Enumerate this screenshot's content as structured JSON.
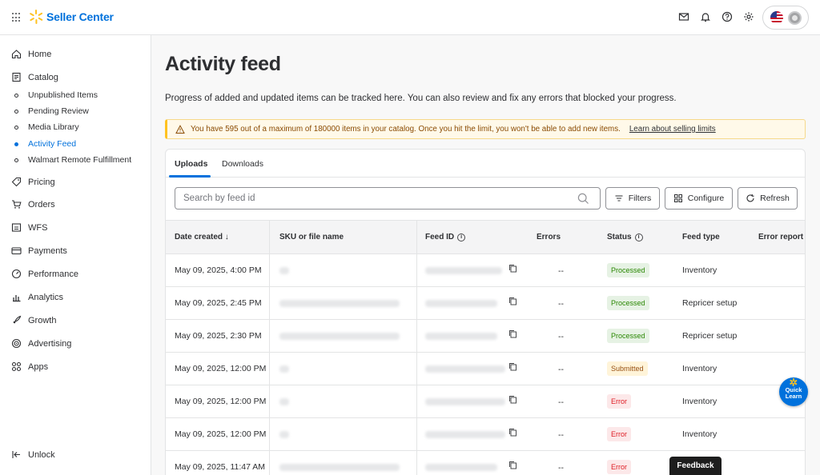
{
  "header": {
    "logo_text": "Seller Center"
  },
  "sidebar": {
    "items": [
      {
        "label": "Home"
      },
      {
        "label": "Catalog"
      },
      {
        "label": "Pricing"
      },
      {
        "label": "Orders"
      },
      {
        "label": "WFS"
      },
      {
        "label": "Payments"
      },
      {
        "label": "Performance"
      },
      {
        "label": "Analytics"
      },
      {
        "label": "Growth"
      },
      {
        "label": "Advertising"
      },
      {
        "label": "Apps"
      }
    ],
    "catalog_sub": [
      {
        "label": "Unpublished Items"
      },
      {
        "label": "Pending Review"
      },
      {
        "label": "Media Library"
      },
      {
        "label": "Activity Feed"
      },
      {
        "label": "Walmart Remote Fulfillment"
      }
    ],
    "unlock_label": "Unlock"
  },
  "main": {
    "title": "Activity feed",
    "description": "Progress of added and updated items can be tracked here. You can also review and fix any errors that blocked your progress.",
    "alert_text": "You have 595 out of a maximum of 180000 items in your catalog. Once you hit the limit, you won't be able to add new items.",
    "alert_link": "Learn about selling limits"
  },
  "tabs": [
    {
      "label": "Uploads"
    },
    {
      "label": "Downloads"
    }
  ],
  "toolbar": {
    "search_placeholder": "Search by feed id",
    "filters_label": "Filters",
    "configure_label": "Configure",
    "refresh_label": "Refresh"
  },
  "table": {
    "columns": [
      "Date created ↓",
      "SKU or file name",
      "Feed ID",
      "Errors",
      "Status",
      "Feed type",
      "Error report"
    ],
    "rows": [
      {
        "date": "May 09, 2025, 4:00 PM",
        "errors": "--",
        "status": "Processed",
        "feed_type": "Inventory"
      },
      {
        "date": "May 09, 2025, 2:45 PM",
        "errors": "--",
        "status": "Processed",
        "feed_type": "Repricer setup"
      },
      {
        "date": "May 09, 2025, 2:30 PM",
        "errors": "--",
        "status": "Processed",
        "feed_type": "Repricer setup"
      },
      {
        "date": "May 09, 2025, 12:00 PM",
        "errors": "--",
        "status": "Submitted",
        "feed_type": "Inventory"
      },
      {
        "date": "May 09, 2025, 12:00 PM",
        "errors": "--",
        "status": "Error",
        "feed_type": "Inventory"
      },
      {
        "date": "May 09, 2025, 12:00 PM",
        "errors": "--",
        "status": "Error",
        "feed_type": "Inventory"
      },
      {
        "date": "May 09, 2025, 11:47 AM",
        "errors": "--",
        "status": "Error",
        "feed_type": ""
      }
    ]
  },
  "quick_learn": {
    "line1": "Quick",
    "line2": "Learn"
  },
  "feedback_label": "Feedback",
  "colors": {
    "brand_blue": "#0071dc",
    "spark_yellow": "#ffc220",
    "processed": "#2a8703",
    "submitted": "#995213",
    "error": "#de1c24"
  }
}
